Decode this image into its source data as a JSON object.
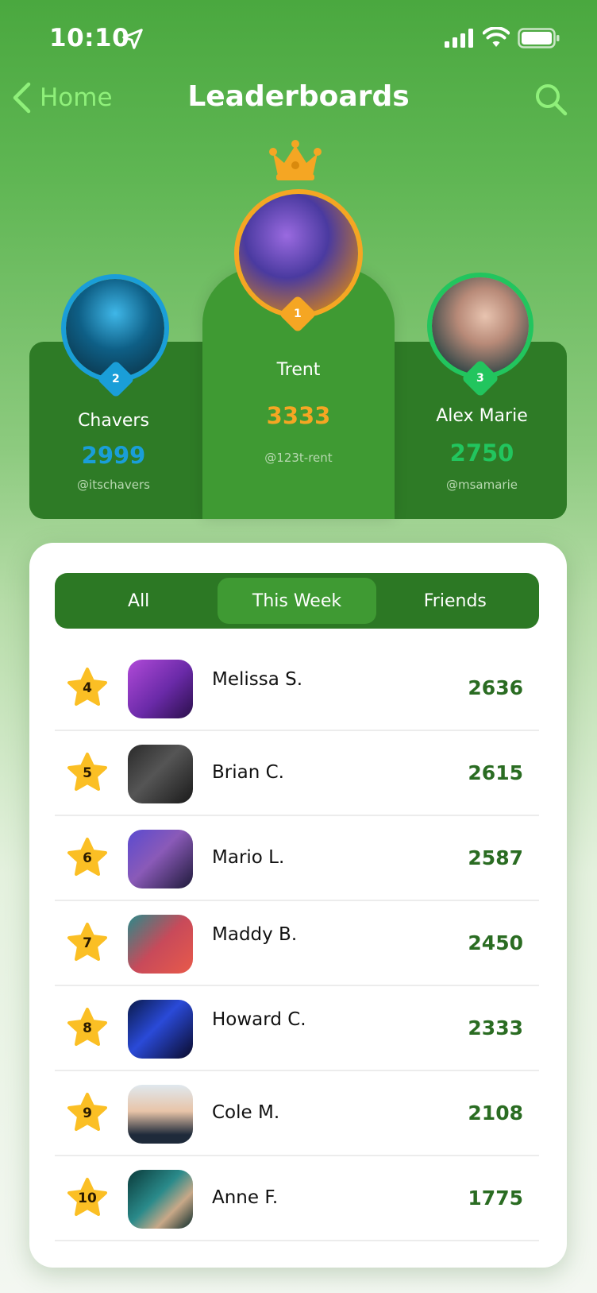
{
  "status_bar": {
    "time": "10:10"
  },
  "nav": {
    "back_label": "Home",
    "title": "Leaderboards"
  },
  "colors": {
    "gold": "#f5a623",
    "silver_blue": "#1a9ed8",
    "green_third": "#22c55e",
    "score_green": "#2a6c22"
  },
  "podium": [
    {
      "rank": "2",
      "name": "Chavers",
      "score": "2999",
      "handle": "@itschavers"
    },
    {
      "rank": "1",
      "name": "Trent",
      "score": "3333",
      "handle": "@123t-rent"
    },
    {
      "rank": "3",
      "name": "Alex Marie",
      "score": "2750",
      "handle": "@msamarie"
    }
  ],
  "tabs": [
    {
      "label": "All"
    },
    {
      "label": "This Week"
    },
    {
      "label": "Friends"
    }
  ],
  "rows": [
    {
      "rank": "4",
      "name": "Melissa S.",
      "score": "2636"
    },
    {
      "rank": "5",
      "name": "Brian C.",
      "score": "2615"
    },
    {
      "rank": "6",
      "name": "Mario L.",
      "score": "2587"
    },
    {
      "rank": "7",
      "name": "Maddy B.",
      "score": "2450"
    },
    {
      "rank": "8",
      "name": "Howard C.",
      "score": "2333"
    },
    {
      "rank": "9",
      "name": "Cole M.",
      "score": "2108"
    },
    {
      "rank": "10",
      "name": "Anne F.",
      "score": "1775"
    }
  ]
}
